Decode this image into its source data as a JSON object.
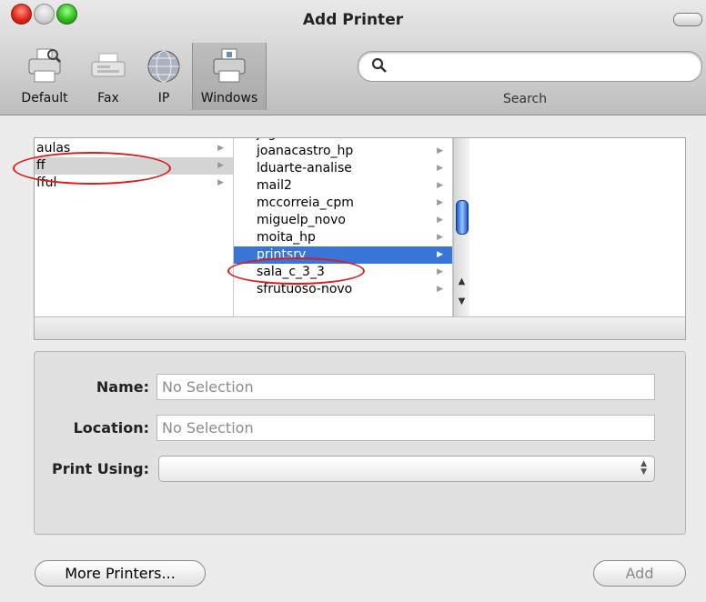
{
  "window": {
    "title": "Add Printer"
  },
  "toolbar": {
    "items": [
      {
        "label": "Default",
        "icon": "default-printer-icon"
      },
      {
        "label": "Fax",
        "icon": "fax-icon"
      },
      {
        "label": "IP",
        "icon": "globe-icon"
      },
      {
        "label": "Windows",
        "icon": "windows-printer-icon",
        "selected": true
      }
    ],
    "search": {
      "placeholder": "",
      "label": "Search"
    }
  },
  "browser": {
    "column1": [
      {
        "label": "aulas",
        "selected": false
      },
      {
        "label": "ff",
        "selected": true
      },
      {
        "label": "fful",
        "selected": false
      }
    ],
    "column2": [
      {
        "label": "jagmorais",
        "selected": false
      },
      {
        "label": "joanacastro_hp",
        "selected": false
      },
      {
        "label": "lduarte-analise",
        "selected": false
      },
      {
        "label": "mail2",
        "selected": false
      },
      {
        "label": "mccorreia_cpm",
        "selected": false
      },
      {
        "label": "miguelp_novo",
        "selected": false
      },
      {
        "label": "moita_hp",
        "selected": false
      },
      {
        "label": "printsrv",
        "selected": true
      },
      {
        "label": "sala_c_3_3",
        "selected": false
      },
      {
        "label": "sfrutuoso-novo",
        "selected": false
      }
    ]
  },
  "form": {
    "name_label": "Name:",
    "name_value": "No Selection",
    "location_label": "Location:",
    "location_value": "No Selection",
    "print_using_label": "Print Using:",
    "print_using_value": ""
  },
  "buttons": {
    "more_printers": "More Printers...",
    "add": "Add"
  },
  "colors": {
    "selection_blue": "#3875d7",
    "annotation_red": "#d51e1e"
  }
}
